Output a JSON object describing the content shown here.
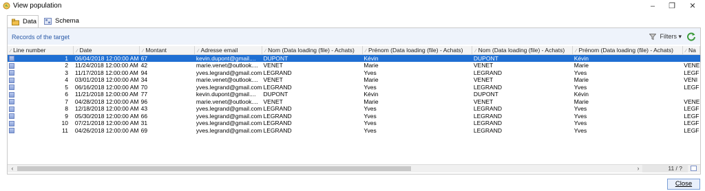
{
  "window": {
    "title": "View population",
    "minimize_glyph": "–",
    "maximize_glyph": "❐",
    "close_glyph": "✕"
  },
  "tabs": [
    {
      "label": "Data",
      "icon": "data-icon",
      "active": true
    },
    {
      "label": "Schema",
      "icon": "schema-icon",
      "active": false
    }
  ],
  "panel": {
    "title": "Records of the target",
    "filters_label": "Filters",
    "filters_arrow": "▾"
  },
  "grid": {
    "columns": [
      "Line number",
      "Date",
      "Montant",
      "Adresse email",
      "Nom (Data loading (file) - Achats)",
      "Prénom (Data loading (file) - Achats)",
      "Nom (Data loading (file) - Achats)",
      "Prénom (Data loading (file) - Achats)",
      "Na"
    ],
    "rows": [
      {
        "line": "1",
        "date": "06/04/2018 12:00:00 AM",
        "montant": "67",
        "email": "kevin.dupont@gmail....",
        "nom1": "DUPONT",
        "prenom1": "Kévin",
        "nom2": "DUPONT",
        "prenom2": "Kévin",
        "extra": ""
      },
      {
        "line": "2",
        "date": "11/24/2018 12:00:00 AM",
        "montant": "42",
        "email": "marie.venet@outlook....",
        "nom1": "VENET",
        "prenom1": "Marie",
        "nom2": "VENET",
        "prenom2": "Marie",
        "extra": "VENE"
      },
      {
        "line": "3",
        "date": "11/17/2018 12:00:00 AM",
        "montant": "94",
        "email": "yves.legrand@gmail.com",
        "nom1": "LEGRAND",
        "prenom1": "Yves",
        "nom2": "LEGRAND",
        "prenom2": "Yves",
        "extra": "LEGF"
      },
      {
        "line": "4",
        "date": "03/01/2018 12:00:00 AM",
        "montant": "34",
        "email": "marie.venet@outlook....",
        "nom1": "VENET",
        "prenom1": "Marie",
        "nom2": "VENET",
        "prenom2": "Marie",
        "extra": "VENI"
      },
      {
        "line": "5",
        "date": "06/16/2018 12:00:00 AM",
        "montant": "70",
        "email": "yves.legrand@gmail.com",
        "nom1": "LEGRAND",
        "prenom1": "Yves",
        "nom2": "LEGRAND",
        "prenom2": "Yves",
        "extra": "LEGF"
      },
      {
        "line": "6",
        "date": "11/21/2018 12:00:00 AM",
        "montant": "77",
        "email": "kevin.dupont@gmail....",
        "nom1": "DUPONT",
        "prenom1": "Kévin",
        "nom2": "DUPONT",
        "prenom2": "Kévin",
        "extra": ""
      },
      {
        "line": "7",
        "date": "04/28/2018 12:00:00 AM",
        "montant": "96",
        "email": "marie.venet@outlook....",
        "nom1": "VENET",
        "prenom1": "Marie",
        "nom2": "VENET",
        "prenom2": "Marie",
        "extra": "VENE"
      },
      {
        "line": "8",
        "date": "12/18/2018 12:00:00 AM",
        "montant": "43",
        "email": "yves.legrand@gmail.com",
        "nom1": "LEGRAND",
        "prenom1": "Yves",
        "nom2": "LEGRAND",
        "prenom2": "Yves",
        "extra": "LEGF"
      },
      {
        "line": "9",
        "date": "05/30/2018 12:00:00 AM",
        "montant": "66",
        "email": "yves.legrand@gmail.com",
        "nom1": "LEGRAND",
        "prenom1": "Yves",
        "nom2": "LEGRAND",
        "prenom2": "Yves",
        "extra": "LEGF"
      },
      {
        "line": "10",
        "date": "07/21/2018 12:00:00 AM",
        "montant": "31",
        "email": "yves.legrand@gmail.com",
        "nom1": "LEGRAND",
        "prenom1": "Yves",
        "nom2": "LEGRAND",
        "prenom2": "Yves",
        "extra": "LEGF"
      },
      {
        "line": "11",
        "date": "04/26/2018 12:00:00 AM",
        "montant": "69",
        "email": "yves.legrand@gmail.com",
        "nom1": "LEGRAND",
        "prenom1": "Yves",
        "nom2": "LEGRAND",
        "prenom2": "Yves",
        "extra": "LEGF"
      }
    ],
    "selected_row": 0
  },
  "scrollbar": {
    "left_arrow": "‹",
    "right_arrow": "›",
    "record_counter": "11 / ?"
  },
  "footer": {
    "close_label": "Close"
  },
  "colors": {
    "selection": "#1f6fd3",
    "link_title": "#2a5aa8",
    "refresh_green": "#3a9a3a"
  }
}
